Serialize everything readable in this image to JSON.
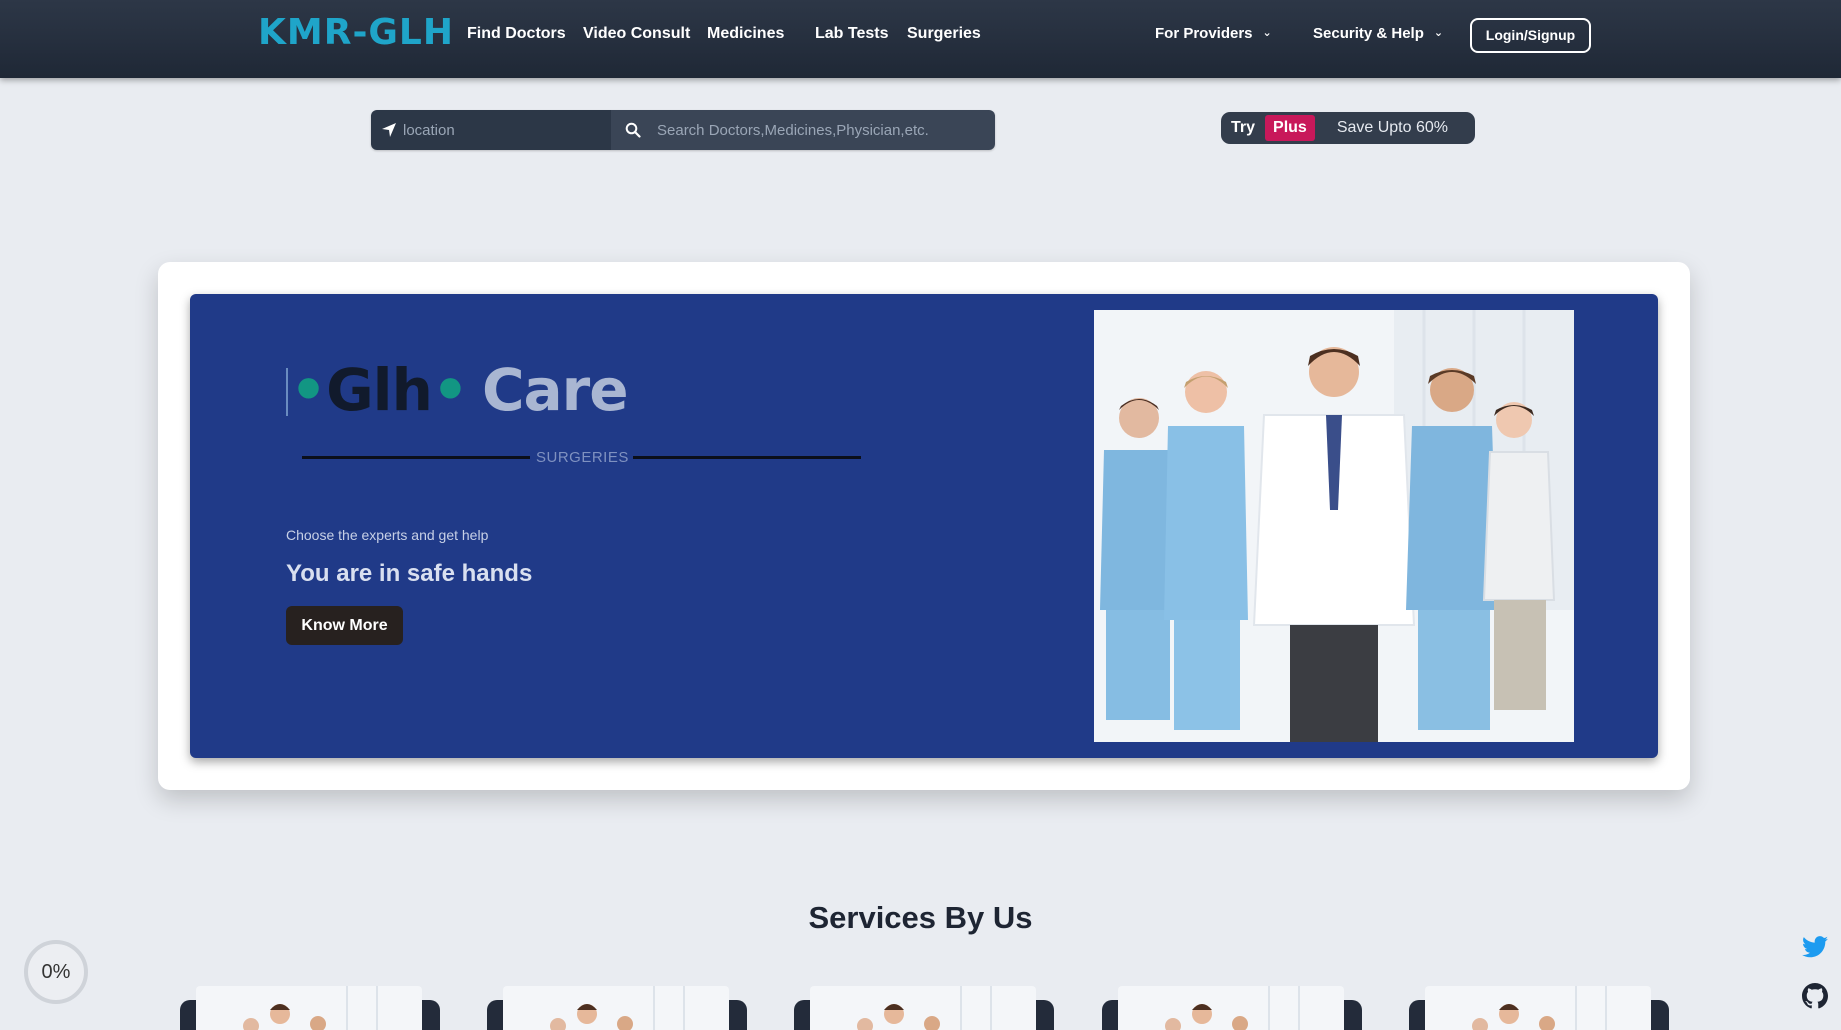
{
  "navbar": {
    "brand": "KMR-GLH",
    "links": [
      "Find Doctors",
      "Video Consult",
      "Medicines",
      "Lab Tests",
      "Surgeries"
    ],
    "dropdowns": [
      "For Providers",
      "Security & Help"
    ],
    "login_label": "Login/Signup"
  },
  "search": {
    "location_placeholder": "location",
    "query_placeholder": "Search Doctors,Medicines,Physician,etc."
  },
  "plus_offer": {
    "try": "Try",
    "plus": "Plus",
    "save": "Save Upto 60%"
  },
  "hero": {
    "title_glh": "Glh",
    "title_care": "Care",
    "subtitle": "SURGERIES",
    "small_text": "Choose the experts and get help",
    "headline": "You are in safe hands",
    "button_label": "Know More"
  },
  "services": {
    "title": "Services By Us"
  },
  "progress": {
    "label": "0%",
    "value": 0
  },
  "colors": {
    "navbar": "#242e3c",
    "brand": "#1fa5c9",
    "hero_bg": "#203a88",
    "plus_badge": "#c8185a",
    "twitter": "#1d9bf0"
  },
  "icons": {
    "location": "location-arrow-icon",
    "search": "search-icon",
    "twitter": "twitter-icon",
    "github": "github-icon",
    "chevron": "chevron-down-icon"
  }
}
